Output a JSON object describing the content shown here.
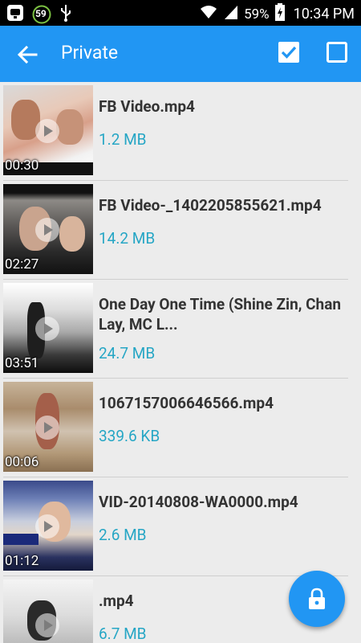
{
  "status_bar": {
    "notif_count": "59",
    "battery": "59%",
    "time": "10:34 PM"
  },
  "app_bar": {
    "title": "Private"
  },
  "videos": [
    {
      "name": "FB Video.mp4",
      "size": "1.2 MB",
      "duration": "00:30"
    },
    {
      "name": "FB Video-_1402205855621.mp4",
      "size": "14.2 MB",
      "duration": "02:27"
    },
    {
      "name": "One Day One Time (Shine Zin, Chan Lay, MC L...",
      "size": "24.7 MB",
      "duration": "03:51"
    },
    {
      "name": "1067157006646566.mp4",
      "size": "339.6 KB",
      "duration": "00:06"
    },
    {
      "name": "VID-20140808-WA0000.mp4",
      "size": "2.6 MB",
      "duration": "01:12"
    },
    {
      "name": ".mp4",
      "size": "6.7 MB",
      "duration": ""
    }
  ],
  "colors": {
    "accent": "#2196F3",
    "size_text": "#26a6c5"
  }
}
